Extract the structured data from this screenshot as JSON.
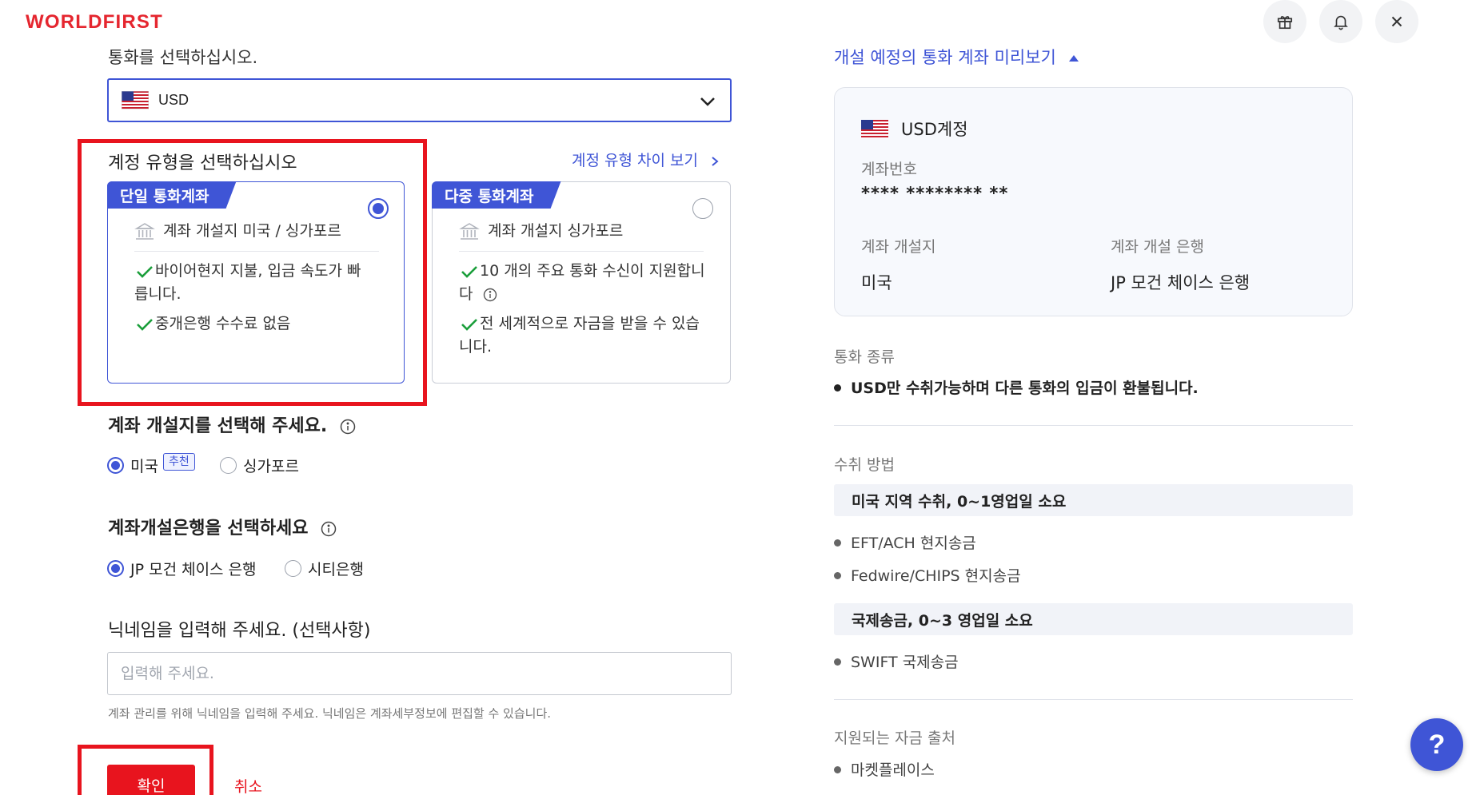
{
  "header": {
    "logo": "WORLDFIRST",
    "icons": [
      "gift-icon",
      "bell-icon",
      "close-icon"
    ]
  },
  "currency": {
    "label": "통화를 선택하십시오.",
    "selected": "USD",
    "flag": "us-flag-icon"
  },
  "account_type": {
    "title": "계정 유형을 선택하십시오",
    "compare_link": "계정 유형 차이 보기",
    "cards": [
      {
        "tag": "단일 통화계좌",
        "selected": true,
        "location": "계좌 개설지 미국 / 싱가포르",
        "features": [
          "바이어현지 지불, 입금 속도가 빠릅니다.",
          "중개은행 수수료 없음"
        ]
      },
      {
        "tag": "다중 통화계좌",
        "selected": false,
        "location": "계좌 개설지 싱가포르",
        "features": [
          "10 개의 주요 통화 수신이 지원합니다",
          "전 세계적으로 자금을 받을 수 있습니다."
        ]
      }
    ]
  },
  "location": {
    "title": "계좌 개설지를 선택해 주세요.",
    "options": [
      {
        "label": "미국",
        "badge": "추천",
        "selected": true
      },
      {
        "label": "싱가포르",
        "selected": false
      }
    ]
  },
  "bank": {
    "title": "계좌개설은행을 선택하세요",
    "options": [
      {
        "label": "JP 모건 체이스 은행",
        "selected": true
      },
      {
        "label": "시티은행",
        "selected": false
      }
    ]
  },
  "nickname": {
    "title": "닉네임을 입력해 주세요. (선택사항)",
    "placeholder": "입력해 주세요.",
    "value": "",
    "hint": "계좌 관리를 위해 닉네임을 입력해 주세요. 닉네임은 계좌세부정보에 편집할 수 있습니다."
  },
  "actions": {
    "confirm": "확인",
    "cancel": "취소"
  },
  "preview": {
    "link": "개설 예정의 통화 계좌 미리보기",
    "card": {
      "title": "USD계정",
      "account_number_label": "계좌번호",
      "account_number": "**** ******** **",
      "location_label": "계좌 개설지",
      "location_value": "미국",
      "bank_label": "계좌 개설 은행",
      "bank_value": "JP 모건 체이스 은행"
    },
    "currency_type": {
      "title": "통화 종류",
      "text": "USD만 수취가능하며 다른 통화의 입금이 환불됩니다."
    },
    "receive_method": {
      "title": "수취 방법",
      "groups": [
        {
          "heading": "미국 지역 수취, 0~1영업일 소요",
          "items": [
            "EFT/ACH 현지송금",
            "Fedwire/CHIPS 현지송금"
          ]
        },
        {
          "heading": "국제송금, 0~3 영업일 소요",
          "items": [
            "SWIFT 국제송금"
          ]
        }
      ]
    },
    "sources": {
      "title": "지원되는 자금 출처",
      "items": [
        "마켓플레이스"
      ]
    }
  },
  "help": {
    "label": "?"
  },
  "colors": {
    "brand_red": "#e8141e",
    "accent_blue": "#3f55d6"
  }
}
